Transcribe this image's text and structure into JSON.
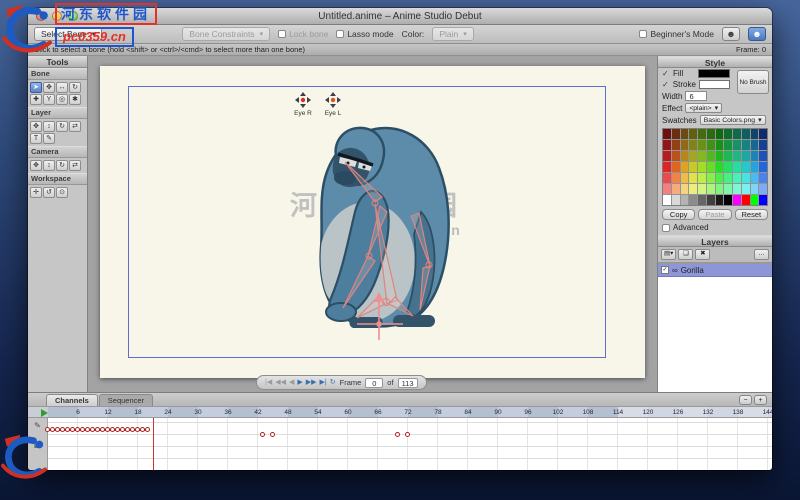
{
  "titlebar": {
    "title": "Untitled.anime – Anime Studio Debut"
  },
  "toolbar": {
    "select_bone": "Select Bone",
    "bone_constraints": "Bone Constraints",
    "lock_bone": "Lock bone",
    "lasso_mode": "Lasso mode",
    "color_label": "Color:",
    "color_value": "Plain",
    "beginners_mode": "Beginner's Mode",
    "icons": [
      {
        "name": "person-icon-button",
        "glyph": "☻"
      },
      {
        "name": "person-icon-button-active",
        "glyph": "☻"
      }
    ]
  },
  "hintbar": {
    "hint": "Click to select a bone (hold <shift> or <ctrl>/<cmd> to select more than one bone)",
    "frame_indicator": "Frame: 0"
  },
  "watermark": {
    "site_name": "河东软件园",
    "site_url": "pc0359.cn",
    "canvas_title": "河东软件园",
    "canvas_url": "www.pc0359.cn"
  },
  "tools": {
    "title": "Tools",
    "sections": [
      {
        "label": "Bone",
        "tools": [
          {
            "name": "select-bone-tool",
            "glyph": "➤",
            "active": true
          },
          {
            "name": "translate-bone-tool",
            "glyph": "✥"
          },
          {
            "name": "scale-bone-tool",
            "glyph": "↔"
          },
          {
            "name": "rotate-bone-tool",
            "glyph": "↻"
          },
          {
            "name": "add-bone-tool",
            "glyph": "✚"
          },
          {
            "name": "reparent-bone-tool",
            "glyph": "Y"
          },
          {
            "name": "bone-strength-tool",
            "glyph": "◎"
          },
          {
            "name": "manipulate-bones-tool",
            "glyph": "✱"
          }
        ]
      },
      {
        "label": "Layer",
        "tools": [
          {
            "name": "translate-layer-tool",
            "glyph": "✥"
          },
          {
            "name": "scale-layer-tool",
            "glyph": "↕"
          },
          {
            "name": "rotate-layer-tool",
            "glyph": "↻"
          },
          {
            "name": "flip-layer-tool",
            "glyph": "⇄"
          },
          {
            "name": "text-tool",
            "glyph": "T"
          },
          {
            "name": "note-tool",
            "glyph": "✎"
          }
        ]
      },
      {
        "label": "Camera",
        "tools": [
          {
            "name": "track-camera-tool",
            "glyph": "✥"
          },
          {
            "name": "zoom-camera-tool",
            "glyph": "↕"
          },
          {
            "name": "roll-camera-tool",
            "glyph": "↻"
          },
          {
            "name": "pan-tilt-camera-tool",
            "glyph": "⇄"
          }
        ]
      },
      {
        "label": "Workspace",
        "tools": [
          {
            "name": "pan-workspace-tool",
            "glyph": "✛"
          },
          {
            "name": "rotate-workspace-tool",
            "glyph": "↺"
          },
          {
            "name": "zoom-workspace-tool",
            "glyph": "⊙"
          }
        ]
      }
    ]
  },
  "canvas": {
    "eye_markers": [
      {
        "label": "Eye R"
      },
      {
        "label": "Eye L"
      }
    ]
  },
  "playback": {
    "buttons": [
      {
        "name": "jump-start-button",
        "glyph": "|◀",
        "enabled": false
      },
      {
        "name": "prev-keyframe-button",
        "glyph": "◀◀",
        "enabled": false
      },
      {
        "name": "step-back-button",
        "glyph": "◀",
        "enabled": false
      },
      {
        "name": "play-button",
        "glyph": "▶",
        "enabled": true
      },
      {
        "name": "step-forward-button",
        "glyph": "▶▶",
        "enabled": true
      },
      {
        "name": "jump-end-button",
        "glyph": "▶|",
        "enabled": true
      },
      {
        "name": "loop-button",
        "glyph": "↻",
        "enabled": true
      }
    ],
    "frame_label": "Frame",
    "frame_value": "0",
    "of_label": "of",
    "total_value": "113"
  },
  "style_panel": {
    "title": "Style",
    "check_glyph": "✓",
    "fill_label": "Fill",
    "stroke_label": "Stroke",
    "fill_color": "#000000",
    "stroke_color": "#ffffff",
    "no_brush_label": "No Brush",
    "width_label": "Width",
    "width_value": "6",
    "effect_label": "Effect",
    "effect_value": "<plain>",
    "swatches_label": "Swatches",
    "swatches_value": "Basic Colors.png",
    "copy_label": "Copy",
    "paste_label": "Paste",
    "reset_label": "Reset",
    "advanced_label": "Advanced",
    "palette_rows": [
      [
        "#6b1010",
        "#6b2f10",
        "#6b4b10",
        "#5f6010",
        "#456b10",
        "#2a6b10",
        "#106b10",
        "#106b2f",
        "#106b4b",
        "#105f60",
        "#10456b",
        "#102a6b"
      ],
      [
        "#921616",
        "#924016",
        "#926716",
        "#828216",
        "#679216",
        "#409216",
        "#169216",
        "#169240",
        "#169267",
        "#168282",
        "#166792",
        "#164092"
      ],
      [
        "#b91c1c",
        "#b9521c",
        "#b9841c",
        "#a6a61c",
        "#84b91c",
        "#52b91c",
        "#1cb91c",
        "#1cb952",
        "#1cb984",
        "#1ca6a6",
        "#1c84b9",
        "#1c52b9"
      ],
      [
        "#de2424",
        "#de6524",
        "#dea324",
        "#c9c924",
        "#a3de24",
        "#65de24",
        "#24de24",
        "#24de65",
        "#24dea3",
        "#24c9c9",
        "#24a3de",
        "#2465de"
      ],
      [
        "#f04848",
        "#f08448",
        "#f0bc48",
        "#e2e248",
        "#bcf048",
        "#84f048",
        "#48f048",
        "#48f084",
        "#48f0bc",
        "#48e2e2",
        "#48bcf0",
        "#4884f0"
      ],
      [
        "#f57f7f",
        "#f5ab7f",
        "#f5d47f",
        "#eeee7f",
        "#d4f57f",
        "#abf57f",
        "#7ff57f",
        "#7ff5ab",
        "#7ff5d4",
        "#7feeee",
        "#7fd4f5",
        "#7fabf5"
      ],
      [
        "#ffffff",
        "#d9d9d9",
        "#b3b3b3",
        "#8c8c8c",
        "#666666",
        "#404040",
        "#1a1a1a",
        "#000000",
        "#ff00ff",
        "#ff0000",
        "#00ff00",
        "#0000ff"
      ]
    ]
  },
  "layers_panel": {
    "title": "Layers",
    "toolbar": [
      {
        "name": "new-layer-button",
        "glyph": "▤▾"
      },
      {
        "name": "duplicate-layer-button",
        "glyph": "❏"
      },
      {
        "name": "delete-layer-button",
        "glyph": "✖"
      },
      {
        "name": "layer-options-button",
        "glyph": "…",
        "right": true
      }
    ],
    "type_glyphs": {
      "bone": "∞"
    },
    "rows": [
      {
        "name": "Gorilla",
        "type": "bone",
        "selected": true
      }
    ]
  },
  "timeline": {
    "tabs": [
      {
        "label": "Channels",
        "active": true
      },
      {
        "label": "Sequencer",
        "active": false
      }
    ],
    "zoom": [
      {
        "name": "timeline-zoom-out-button",
        "glyph": "−"
      },
      {
        "name": "timeline-zoom-in-button",
        "glyph": "+"
      }
    ],
    "gutter_icons": [
      {
        "name": "edit-channel-icon",
        "glyph": "✎"
      },
      {
        "name": "channel-list-icon",
        "glyph": "▦"
      }
    ],
    "ruler_labels": [
      6,
      12,
      18,
      24,
      30,
      36,
      42,
      48,
      54,
      60,
      66,
      72,
      78,
      84,
      90,
      96,
      102,
      108,
      114,
      120,
      126,
      132,
      138,
      144
    ],
    "playhead_frame": 0,
    "light_zone_start": 114,
    "keyframes": {
      "chain_start": 0,
      "chain_end": 20,
      "pairs": [
        [
          43,
          45
        ],
        [
          70,
          72
        ]
      ],
      "cursor_frame": 21
    }
  }
}
